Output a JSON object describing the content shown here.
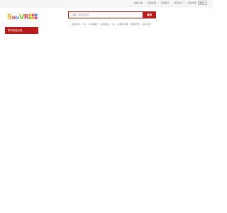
{
  "topbar": {
    "links": [
      "我的订单",
      "我的收藏",
      "我的账户",
      "帮助中心",
      "退出登录"
    ],
    "language": "简体"
  },
  "brand": {
    "logo_text": "SouVR",
    "logo_colors": [
      "#f5a623",
      "#e94e77",
      "#4a90e2",
      "#7ed321"
    ]
  },
  "search": {
    "placeholder": "请输入搜索关键字",
    "button_label": "搜索"
  },
  "hot_keywords": [
    "虚拟现实",
    "3D",
    "动作捕捉",
    "位置跟踪",
    "VR",
    "立体显示器",
    "数据手套",
    "虚拟仿真"
  ],
  "category": {
    "label": "所有商品分类"
  },
  "colors": {
    "accent": "#b71c1c",
    "topbar_bg": "#f6f6f6"
  }
}
